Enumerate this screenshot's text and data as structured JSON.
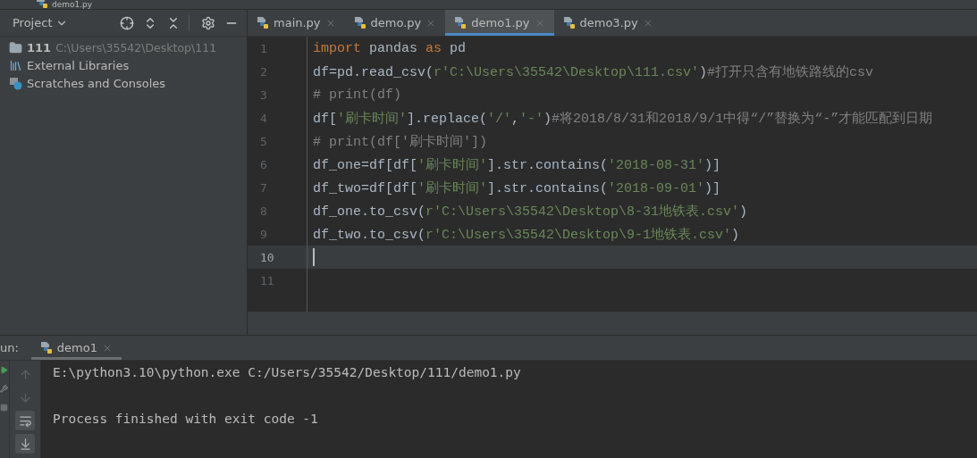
{
  "top_strip": {
    "file": "demo1.py"
  },
  "project_panel": {
    "title": "Project",
    "tree": [
      {
        "kind": "folder",
        "name": "111",
        "path": "C:\\Users\\35542\\Desktop\\111"
      },
      {
        "kind": "libraries",
        "name": "External Libraries"
      },
      {
        "kind": "scratches",
        "name": "Scratches and Consoles"
      }
    ]
  },
  "tabs": [
    {
      "label": "main.py",
      "selected": false
    },
    {
      "label": "demo.py",
      "selected": false
    },
    {
      "label": "demo1.py",
      "selected": true
    },
    {
      "label": "demo3.py",
      "selected": false
    }
  ],
  "editor": {
    "lines": [
      {
        "number": "1",
        "current": false,
        "segments": [
          {
            "kind": "keyword",
            "text": "import"
          },
          {
            "kind": "plain",
            "text": " pandas "
          },
          {
            "kind": "keyword",
            "text": "as"
          },
          {
            "kind": "plain",
            "text": " pd"
          }
        ]
      },
      {
        "number": "2",
        "current": false,
        "segments": [
          {
            "kind": "plain",
            "text": "df=pd.read_csv("
          },
          {
            "kind": "string",
            "text": "r'C:\\Users\\35542\\Desktop\\111.csv'"
          },
          {
            "kind": "plain",
            "text": ")"
          },
          {
            "kind": "comment",
            "text": "#打开只含有地铁路线的csv"
          }
        ]
      },
      {
        "number": "3",
        "current": false,
        "segments": [
          {
            "kind": "comment",
            "text": "# print(df)"
          }
        ]
      },
      {
        "number": "4",
        "current": false,
        "segments": [
          {
            "kind": "plain",
            "text": "df["
          },
          {
            "kind": "string",
            "text": "'刷卡时间'"
          },
          {
            "kind": "plain",
            "text": "].replace("
          },
          {
            "kind": "string",
            "text": "'/'"
          },
          {
            "kind": "plain",
            "text": ","
          },
          {
            "kind": "string",
            "text": "'-'"
          },
          {
            "kind": "plain",
            "text": ")"
          },
          {
            "kind": "comment",
            "text": "#将2018/8/31和2018/9/1中得“/”替换为“-”才能匹配到日期"
          }
        ]
      },
      {
        "number": "5",
        "current": false,
        "segments": [
          {
            "kind": "comment",
            "text": "# print(df['刷卡时间'])"
          }
        ]
      },
      {
        "number": "6",
        "current": false,
        "segments": [
          {
            "kind": "plain",
            "text": "df_one=df[df["
          },
          {
            "kind": "string",
            "text": "'刷卡时间'"
          },
          {
            "kind": "plain",
            "text": "].str.contains("
          },
          {
            "kind": "string",
            "text": "'2018-08-31'"
          },
          {
            "kind": "plain",
            "text": ")]"
          }
        ]
      },
      {
        "number": "7",
        "current": false,
        "segments": [
          {
            "kind": "plain",
            "text": "df_two=df[df["
          },
          {
            "kind": "string",
            "text": "'刷卡时间'"
          },
          {
            "kind": "plain",
            "text": "].str.contains("
          },
          {
            "kind": "string",
            "text": "'2018-09-01'"
          },
          {
            "kind": "plain",
            "text": ")]"
          }
        ]
      },
      {
        "number": "8",
        "current": false,
        "segments": [
          {
            "kind": "plain",
            "text": "df_one.to_csv("
          },
          {
            "kind": "string",
            "text": "r'C:\\Users\\35542\\Desktop\\8-31地铁表.csv'"
          },
          {
            "kind": "plain",
            "text": ")"
          }
        ]
      },
      {
        "number": "9",
        "current": false,
        "segments": [
          {
            "kind": "plain",
            "text": "df_two.to_csv("
          },
          {
            "kind": "string",
            "text": "r'C:\\Users\\35542\\Desktop\\9-1地铁表.csv'"
          },
          {
            "kind": "plain",
            "text": ")"
          }
        ]
      },
      {
        "number": "10",
        "current": true
      },
      {
        "number": "11",
        "current": false
      }
    ]
  },
  "run_panel": {
    "label": "un:",
    "tab": {
      "label": "demo1",
      "selected": true
    },
    "output": [
      "E:\\python3.10\\python.exe C:/Users/35542/Desktop/111/demo1.py",
      "Process finished with exit code -1"
    ]
  }
}
